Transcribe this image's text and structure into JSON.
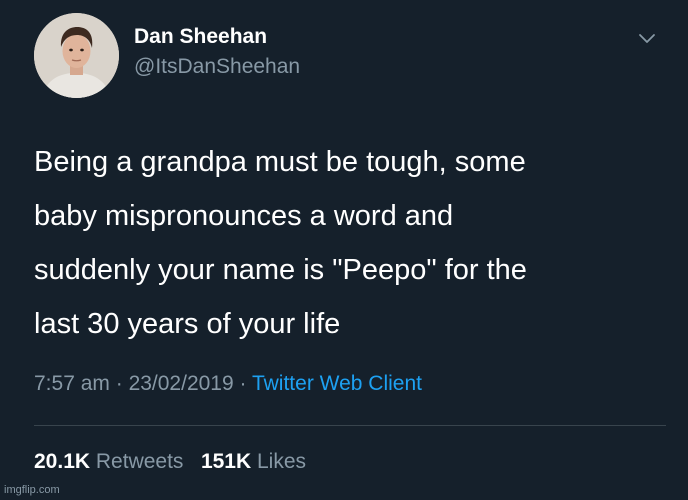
{
  "user": {
    "display_name": "Dan Sheehan",
    "handle": "@ItsDanSheehan"
  },
  "tweet": {
    "lines": [
      "Being a grandpa must be tough, some",
      "baby mispronounces a word and",
      "suddenly your name is \"Peepo\" for the",
      "last 30 years of your life"
    ]
  },
  "meta": {
    "time": "7:57 am",
    "separator": " · ",
    "date": "23/02/2019",
    "client": "Twitter Web Client"
  },
  "stats": {
    "retweets_count": "20.1K",
    "retweets_label": "Retweets",
    "likes_count": "151K",
    "likes_label": "Likes"
  },
  "watermark": "imgflip.com",
  "icons": {
    "menu": "chevron-down-icon",
    "avatar": "avatar"
  },
  "colors": {
    "background": "#15202b",
    "secondary_text": "#8899a6",
    "link": "#1da1f2",
    "divider": "#38444d"
  }
}
